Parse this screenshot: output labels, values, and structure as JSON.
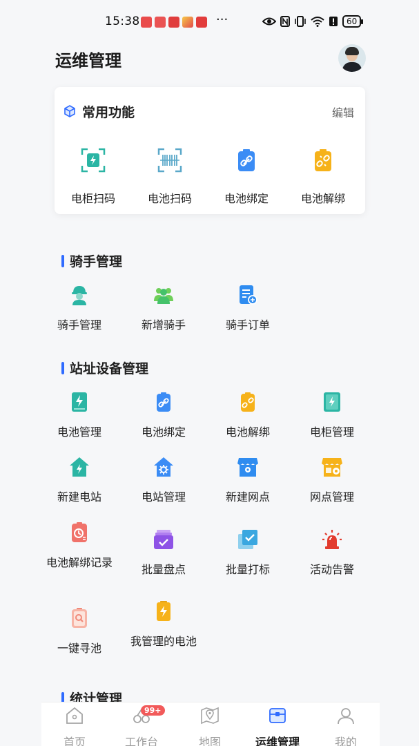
{
  "status_bar": {
    "time": "15:38",
    "battery": "60",
    "more": "···"
  },
  "header": {
    "title": "运维管理"
  },
  "favorites": {
    "title": "常用功能",
    "edit_label": "编辑",
    "items": [
      {
        "label": "电柜扫码",
        "icon": "cabinet-scan-icon"
      },
      {
        "label": "电池扫码",
        "icon": "battery-barcode-scan-icon"
      },
      {
        "label": "电池绑定",
        "icon": "battery-bind-icon"
      },
      {
        "label": "电池解绑",
        "icon": "battery-unbind-icon"
      }
    ]
  },
  "rider_section": {
    "title": "骑手管理",
    "items": [
      {
        "label": "骑手管理",
        "icon": "rider-icon"
      },
      {
        "label": "新增骑手",
        "icon": "add-rider-icon"
      },
      {
        "label": "骑手订单",
        "icon": "rider-order-icon"
      }
    ]
  },
  "station_section": {
    "title": "站址设备管理",
    "items": [
      {
        "label": "电池管理",
        "icon": "battery-manage-icon"
      },
      {
        "label": "电池绑定",
        "icon": "battery-bind-icon"
      },
      {
        "label": "电池解绑",
        "icon": "battery-unbind-icon"
      },
      {
        "label": "电柜管理",
        "icon": "cabinet-manage-icon"
      },
      {
        "label": "新建电站",
        "icon": "new-station-icon"
      },
      {
        "label": "电站管理",
        "icon": "station-manage-icon"
      },
      {
        "label": "新建网点",
        "icon": "new-outlet-icon"
      },
      {
        "label": "网点管理",
        "icon": "outlet-manage-icon"
      },
      {
        "label": "电池解绑记录",
        "icon": "unbind-record-icon"
      },
      {
        "label": "批量盘点",
        "icon": "batch-inventory-icon"
      },
      {
        "label": "批量打标",
        "icon": "batch-tag-icon"
      },
      {
        "label": "活动告警",
        "icon": "alarm-icon"
      },
      {
        "label": "一键寻池",
        "icon": "find-battery-icon"
      },
      {
        "label": "我管理的电池",
        "icon": "my-battery-icon"
      }
    ]
  },
  "stats_section": {
    "title": "统计管理"
  },
  "tabbar": {
    "badge": "99+",
    "tabs": [
      {
        "label": "首页",
        "icon": "home-icon"
      },
      {
        "label": "工作台",
        "icon": "workbench-icon"
      },
      {
        "label": "地图",
        "icon": "map-icon"
      },
      {
        "label": "运维管理",
        "icon": "ops-icon",
        "active": true
      },
      {
        "label": "我的",
        "icon": "profile-icon"
      }
    ]
  },
  "colors": {
    "accent": "#2f6bff",
    "teal": "#2bb5a4",
    "blue": "#3b8cf5",
    "orange": "#f6b21a",
    "green": "#45c26a",
    "red": "#e23b2e"
  }
}
